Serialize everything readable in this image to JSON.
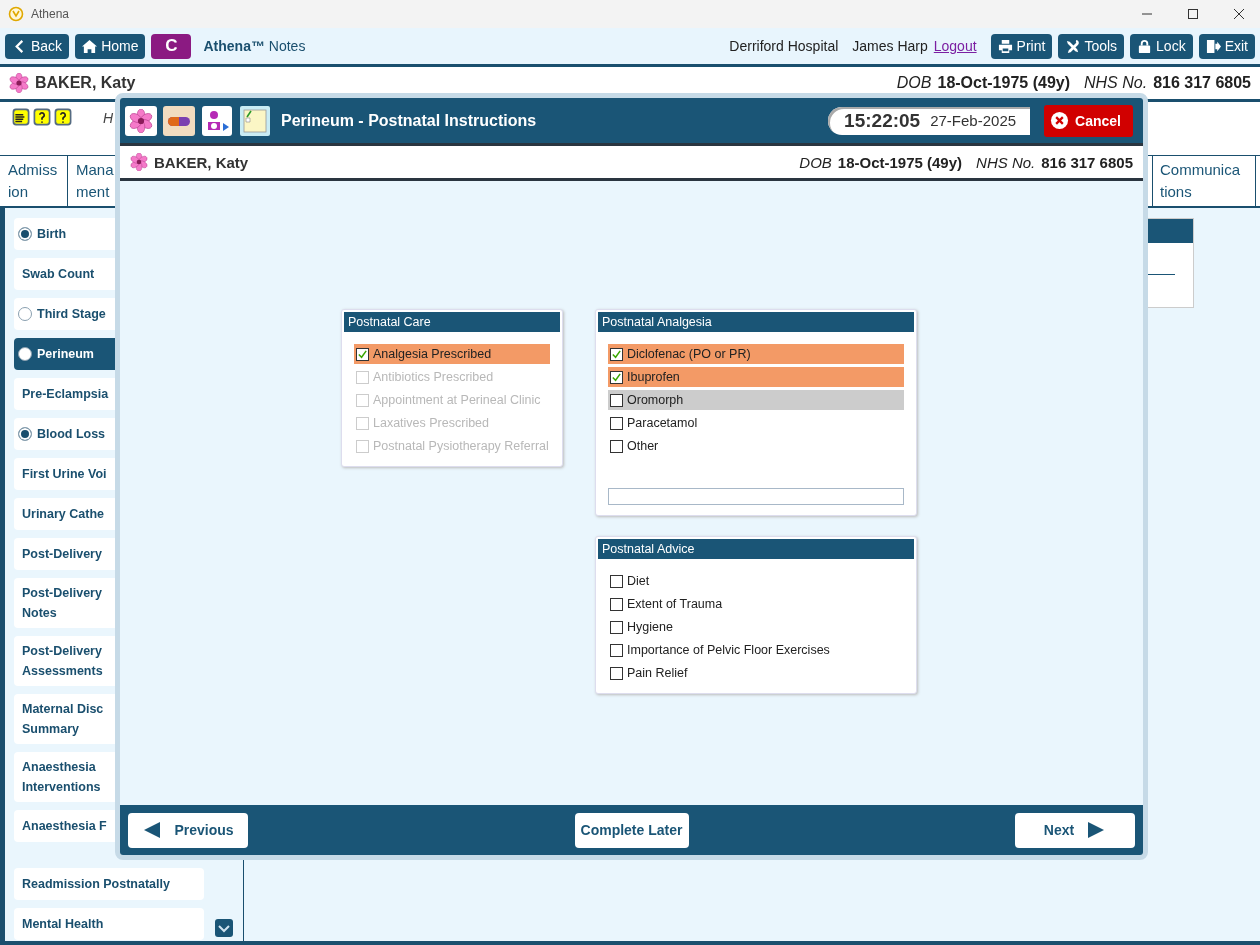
{
  "window": {
    "title": "Athena"
  },
  "toolbar": {
    "left_buttons": [
      {
        "kind": "back",
        "label": "Back"
      },
      {
        "kind": "home",
        "label": "Home"
      },
      {
        "kind": "badge",
        "label": "C"
      }
    ],
    "app_name": "**Athena™** Notes",
    "location": "Derriford Hospital",
    "user": "James Harp",
    "logout": "Logout",
    "right_buttons": [
      {
        "kind": "print",
        "label": "Print"
      },
      {
        "kind": "tools",
        "label": "Tools"
      },
      {
        "kind": "lock",
        "label": "Lock"
      },
      {
        "kind": "exit",
        "label": "Exit"
      }
    ]
  },
  "patient": {
    "name": "BAKER, Katy",
    "dob_label": "DOB",
    "dob": "18-Oct-1975 (49y)",
    "nhs_label": "NHS No.",
    "nhs": "816 317 6805"
  },
  "header_text": "H",
  "tabs": [
    {
      "lines": [
        "Admiss",
        "ion"
      ]
    },
    {
      "lines": [
        "Mana",
        "ment"
      ]
    },
    {
      "lines": [
        "Communica",
        "tions"
      ]
    }
  ],
  "sidebar": {
    "groups": [
      [
        {
          "kind": "radio",
          "lines": [
            "Birth"
          ],
          "checked": true,
          "selected": false
        },
        {
          "kind": "plain",
          "lines": [
            "Swab Count"
          ],
          "selected": false
        },
        {
          "kind": "radio",
          "lines": [
            "Third Stage"
          ],
          "checked": false,
          "selected": false
        },
        {
          "kind": "radio",
          "lines": [
            "Perineum"
          ],
          "checked": false,
          "selected": true
        },
        {
          "kind": "plain",
          "lines": [
            "Pre-Eclampsia"
          ],
          "selected": false
        },
        {
          "kind": "radio",
          "lines": [
            "Blood Loss"
          ],
          "checked": true,
          "selected": false
        },
        {
          "kind": "plain",
          "lines": [
            "First Urine Voi"
          ],
          "selected": false
        },
        {
          "kind": "plain",
          "lines": [
            "Urinary Cathe"
          ],
          "selected": false
        },
        {
          "kind": "plain",
          "lines": [
            "Post-Delivery"
          ],
          "selected": false
        },
        {
          "kind": "plain",
          "lines": [
            "Post-Delivery",
            "Notes"
          ],
          "selected": false
        },
        {
          "kind": "plain",
          "lines": [
            "Post-Delivery",
            "Assessments"
          ],
          "selected": false
        },
        {
          "kind": "plain",
          "lines": [
            "Maternal Disc",
            "Summary"
          ],
          "selected": false
        },
        {
          "kind": "plain",
          "lines": [
            "Anaesthesia",
            "Interventions"
          ],
          "selected": false
        },
        {
          "kind": "plain",
          "lines": [
            "Anaesthesia F"
          ],
          "selected": false
        }
      ],
      [
        {
          "kind": "plain",
          "lines": [
            "Readmission Postnatally"
          ],
          "selected": false
        },
        {
          "kind": "plain",
          "lines": [
            "Mental Health"
          ],
          "selected": false
        }
      ]
    ]
  },
  "dialog": {
    "title": "Perineum - Postnatal Instructions",
    "time": "15:22:05",
    "date": "27-Feb-2025",
    "cancel": "Cancel",
    "patient": {
      "name": "BAKER, Katy",
      "dob_label": "DOB",
      "dob": "18-Oct-1975 (49y)",
      "nhs_label": "NHS No.",
      "nhs": "816 317 6805"
    },
    "columns": [
      [
        {
          "title": "Postnatal Care",
          "text_field": false,
          "items": [
            {
              "label": "Analgesia Prescribed",
              "checked": true,
              "disabled": false,
              "focused": false
            },
            {
              "label": "Antibiotics Prescribed",
              "checked": false,
              "disabled": true,
              "focused": false
            },
            {
              "label": "Appointment at Perineal Clinic",
              "checked": false,
              "disabled": true,
              "focused": false
            },
            {
              "label": "Laxatives Prescribed",
              "checked": false,
              "disabled": true,
              "focused": false
            },
            {
              "label": "Postnatal Pysiotherapy Referral",
              "checked": false,
              "disabled": true,
              "focused": false
            }
          ]
        }
      ],
      [
        {
          "title": "Postnatal Analgesia",
          "text_field": true,
          "items": [
            {
              "label": "Diclofenac (PO or PR)",
              "checked": true,
              "disabled": false,
              "focused": false
            },
            {
              "label": "Ibuprofen",
              "checked": true,
              "disabled": false,
              "focused": false
            },
            {
              "label": "Oromorph",
              "checked": false,
              "disabled": false,
              "focused": true
            },
            {
              "label": "Paracetamol",
              "checked": false,
              "disabled": false,
              "focused": false
            },
            {
              "label": "Other",
              "checked": false,
              "disabled": false,
              "focused": false
            }
          ]
        },
        {
          "title": "Postnatal Advice",
          "text_field": false,
          "items": [
            {
              "label": "Diet",
              "checked": false,
              "disabled": false,
              "focused": false
            },
            {
              "label": "Extent of Trauma",
              "checked": false,
              "disabled": false,
              "focused": false
            },
            {
              "label": "Hygiene",
              "checked": false,
              "disabled": false,
              "focused": false
            },
            {
              "label": "Importance of Pelvic Floor Exercises",
              "checked": false,
              "disabled": false,
              "focused": false
            },
            {
              "label": "Pain Relief",
              "checked": false,
              "disabled": false,
              "focused": false
            }
          ]
        }
      ]
    ],
    "footer": {
      "previous": "Previous",
      "complete_later": "Complete Later",
      "next": "Next"
    }
  }
}
